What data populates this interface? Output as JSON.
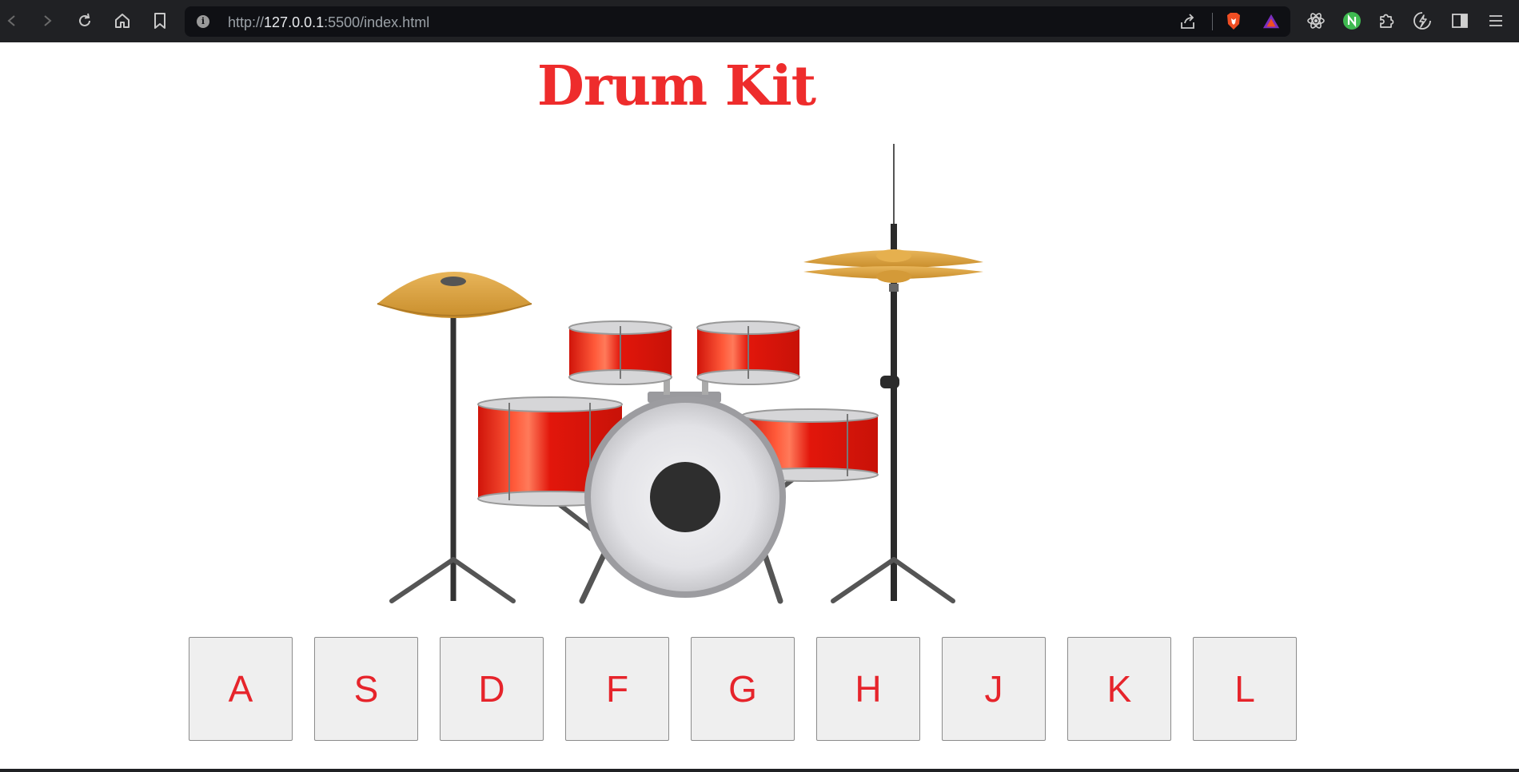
{
  "browser": {
    "url_scheme": "http://",
    "url_host": "127.0.0.1",
    "url_rest": ":5500/index.html"
  },
  "page": {
    "title": "Drum Kit",
    "title_color": "#ee2c2c",
    "pads": [
      "A",
      "S",
      "D",
      "F",
      "G",
      "H",
      "J",
      "K",
      "L"
    ],
    "pad_text_color": "#e6242b",
    "pad_background": "#efefef"
  }
}
